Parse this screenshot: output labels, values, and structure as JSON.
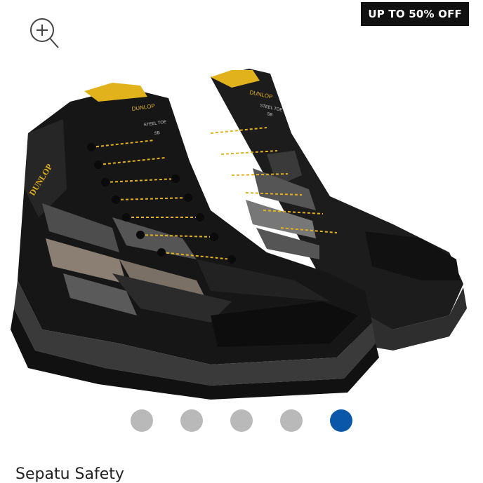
{
  "badge": {
    "text": "UP TO 50% OFF"
  },
  "product": {
    "title": "Sepatu Safety",
    "brand_print": "DUNLOP",
    "tongue_print_1": "STEEL TOE",
    "tongue_print_2": "SB"
  },
  "gallery": {
    "slide_count": 5,
    "active_index": 4
  },
  "colors": {
    "active_dot": "#0a56a8",
    "inactive_dot": "#b9b9b9",
    "badge_bg": "#111111",
    "boot_accent": "#e2b21c"
  },
  "icons": {
    "zoom": "zoom-in-icon"
  }
}
